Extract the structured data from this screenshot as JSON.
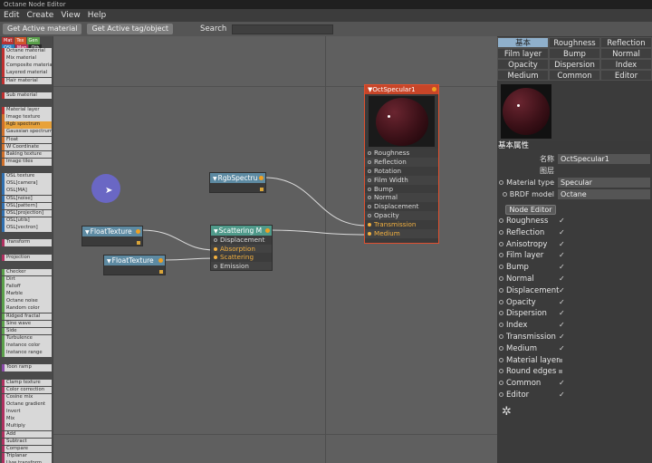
{
  "window_title": "Octane Node Editor",
  "menu": [
    "Edit",
    "Create",
    "View",
    "Help"
  ],
  "toolbar": {
    "get_material": "Get Active material",
    "get_tag": "Get Active tag/object",
    "search_label": "Search",
    "search_value": ""
  },
  "palette_tabs": [
    {
      "label": "Mat",
      "color": "#b83232"
    },
    {
      "label": "Tex",
      "color": "#d0552a"
    },
    {
      "label": "Gen",
      "color": "#5aa04a"
    },
    {
      "label": "OSL",
      "color": "#2a7fbf"
    },
    {
      "label": "Map",
      "color": "#b03060"
    },
    {
      "label": "Oth",
      "color": "#2a2a2a"
    },
    {
      "label": "Ems",
      "color": "#7a6aa8"
    },
    {
      "label": "Med",
      "color": "#3a9a9a"
    },
    {
      "label": "C4D",
      "color": "#1a1a1a"
    }
  ],
  "node_list": [
    {
      "label": "Octane material",
      "color": "#c03030"
    },
    {
      "label": "Mix material",
      "color": "#c03030"
    },
    {
      "label": "Composite material",
      "color": "#c03030"
    },
    {
      "label": "Layered material",
      "color": "#c03030"
    },
    {
      "label": "Hair material",
      "color": "#c03030"
    },
    {
      "label": "",
      "color": "#4a4a4a"
    },
    {
      "label": "Sub material",
      "color": "#c03030"
    },
    {
      "label": "",
      "color": "#4a4a4a"
    },
    {
      "label": "Material layer",
      "color": "#c03030"
    },
    {
      "label": "Image texture",
      "color": "#d0702a"
    },
    {
      "label": "Rgb spectrum",
      "color": "#d0702a",
      "highlight": true
    },
    {
      "label": "Gaussian spectrum",
      "color": "#d0702a"
    },
    {
      "label": "Float",
      "color": "#d0702a"
    },
    {
      "label": "W Coordinate",
      "color": "#d0702a"
    },
    {
      "label": "Baking texture",
      "color": "#d0702a"
    },
    {
      "label": "Image tiles",
      "color": "#d0702a"
    },
    {
      "label": "",
      "color": "#4a4a4a"
    },
    {
      "label": "OSL texture",
      "color": "#3070b0"
    },
    {
      "label": "OSL[camera]",
      "color": "#3070b0"
    },
    {
      "label": "OSL[MA]",
      "color": "#3070b0"
    },
    {
      "label": "OSL[noise]",
      "color": "#3070b0"
    },
    {
      "label": "OSL[pattern]",
      "color": "#3070b0"
    },
    {
      "label": "OSL[projection]",
      "color": "#3070b0"
    },
    {
      "label": "OSL[utils]",
      "color": "#3070b0"
    },
    {
      "label": "OSL[vectron]",
      "color": "#3070b0"
    },
    {
      "label": "",
      "color": "#4a4a4a"
    },
    {
      "label": "Transform",
      "color": "#b03060"
    },
    {
      "label": "",
      "color": "#4a4a4a"
    },
    {
      "label": "Projection",
      "color": "#b03060"
    },
    {
      "label": "",
      "color": "#4a4a4a"
    },
    {
      "label": "Checker",
      "color": "#5aa04a"
    },
    {
      "label": "Dirt",
      "color": "#5aa04a"
    },
    {
      "label": "Falloff",
      "color": "#5aa04a"
    },
    {
      "label": "Marble",
      "color": "#5aa04a"
    },
    {
      "label": "Octane noise",
      "color": "#5aa04a"
    },
    {
      "label": "Random color",
      "color": "#5aa04a"
    },
    {
      "label": "Ridged fractal",
      "color": "#5aa04a"
    },
    {
      "label": "Sine wave",
      "color": "#5aa04a"
    },
    {
      "label": "Side",
      "color": "#5aa04a"
    },
    {
      "label": "Turbulence",
      "color": "#5aa04a"
    },
    {
      "label": "Instance color",
      "color": "#5aa04a"
    },
    {
      "label": "Instance range",
      "color": "#5aa04a"
    },
    {
      "label": "",
      "color": "#4a4a4a"
    },
    {
      "label": "Toon ramp",
      "color": "#8a4aa8"
    },
    {
      "label": "",
      "color": "#4a4a4a"
    },
    {
      "label": "Clamp texture",
      "color": "#b03060"
    },
    {
      "label": "Color correction",
      "color": "#b03060"
    },
    {
      "label": "Cosine mix",
      "color": "#b03060"
    },
    {
      "label": "Octane gradient",
      "color": "#b03060"
    },
    {
      "label": "Invert",
      "color": "#b03060"
    },
    {
      "label": "Mix",
      "color": "#b03060"
    },
    {
      "label": "Multiply",
      "color": "#b03060"
    },
    {
      "label": "Add",
      "color": "#b03060"
    },
    {
      "label": "Subtract",
      "color": "#b03060"
    },
    {
      "label": "Compare",
      "color": "#b03060"
    },
    {
      "label": "Triplanar",
      "color": "#b03060"
    },
    {
      "label": "Uvw transform",
      "color": "#b03060"
    },
    {
      "label": "Displacement",
      "color": "#b03060"
    }
  ],
  "nodes": {
    "rgb": {
      "title": "RgbSpectru"
    },
    "float1": {
      "title": "FloatTexture"
    },
    "float2": {
      "title": "FloatTexture"
    },
    "scatter": {
      "title": "Scattering M",
      "ports": [
        "Displacement",
        "Absorption",
        "Scattering",
        "Emission"
      ]
    },
    "material": {
      "title": "OctSpecular1",
      "ports": [
        "Roughness",
        "Reflection",
        "Rotation",
        "Film Width",
        "Bump",
        "Normal",
        "Displacement",
        "Opacity",
        "Transmission",
        "Medium"
      ]
    }
  },
  "props": {
    "tabs": [
      "基本",
      "Roughness",
      "Reflection",
      "Film layer",
      "Bump",
      "Normal",
      "Opacity",
      "Dispersion",
      "Index",
      "Medium",
      "Common",
      "Editor"
    ],
    "section_title": "基本属性",
    "name_label": "名称",
    "name_value": "OctSpecular1",
    "layer_label": "图层",
    "material_type_label": "Material type",
    "material_type_value": "Specular",
    "brdf_label": "BRDF model",
    "brdf_value": "Octane",
    "node_editor_button": "Node Editor",
    "channels": [
      {
        "label": "Roughness",
        "mark": "check"
      },
      {
        "label": "Reflection",
        "mark": "check"
      },
      {
        "label": "Anisotropy",
        "mark": "check"
      },
      {
        "label": "Film layer",
        "mark": "check"
      },
      {
        "label": "Bump",
        "mark": "check"
      },
      {
        "label": "Normal",
        "mark": "check"
      },
      {
        "label": "Displacement",
        "mark": "check"
      },
      {
        "label": "Opacity",
        "mark": "check"
      },
      {
        "label": "Dispersion",
        "mark": "check"
      },
      {
        "label": "Index",
        "mark": "check"
      },
      {
        "label": "Transmission",
        "mark": "check"
      },
      {
        "label": "Medium",
        "mark": "check"
      },
      {
        "label": "Material layer",
        "mark": "square"
      },
      {
        "label": "Round edges",
        "mark": "square"
      },
      {
        "label": "Common",
        "mark": "check"
      },
      {
        "label": "Editor",
        "mark": "check"
      }
    ]
  }
}
